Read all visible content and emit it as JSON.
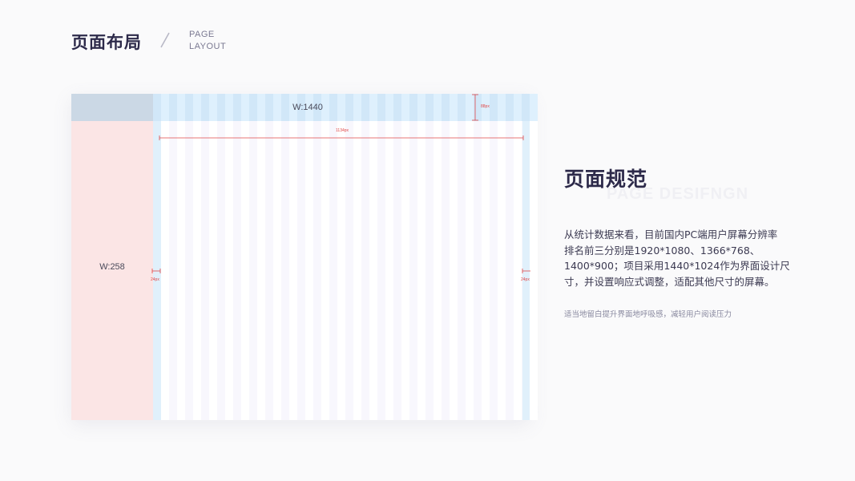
{
  "header": {
    "title": "页面布局",
    "subtitle_line1": "PAGE",
    "subtitle_line2": "LAYOUT"
  },
  "diagram": {
    "topbar_label": "W:1440",
    "sidebar_label": "W:258",
    "header_height_label": "88px",
    "content_width_label": "1134px",
    "left_margin_label": "24px",
    "right_margin_label": "24px",
    "colors": {
      "sidebar": "#fbe5e5",
      "topbar": "#d1e7f8",
      "corner": "#cbd8e5",
      "columns": "#ffffff",
      "gutters": "#f8f7fd",
      "measure": "#e04848"
    }
  },
  "spec": {
    "title": "页面规范",
    "watermark": "PAGE DESIFNGN",
    "body_lines": [
      "从统计数据来看，目前国内PC端用户屏幕分辨率",
      "排名前三分别是1920*1080、1366*768、",
      "1400*900；项目采用1440*1024作为界面设计尺",
      "寸，并设置响应式调整，适配其他尺寸的屏幕。"
    ],
    "note": "适当地留白提升界面地呼吸感，减轻用户阅读压力"
  }
}
